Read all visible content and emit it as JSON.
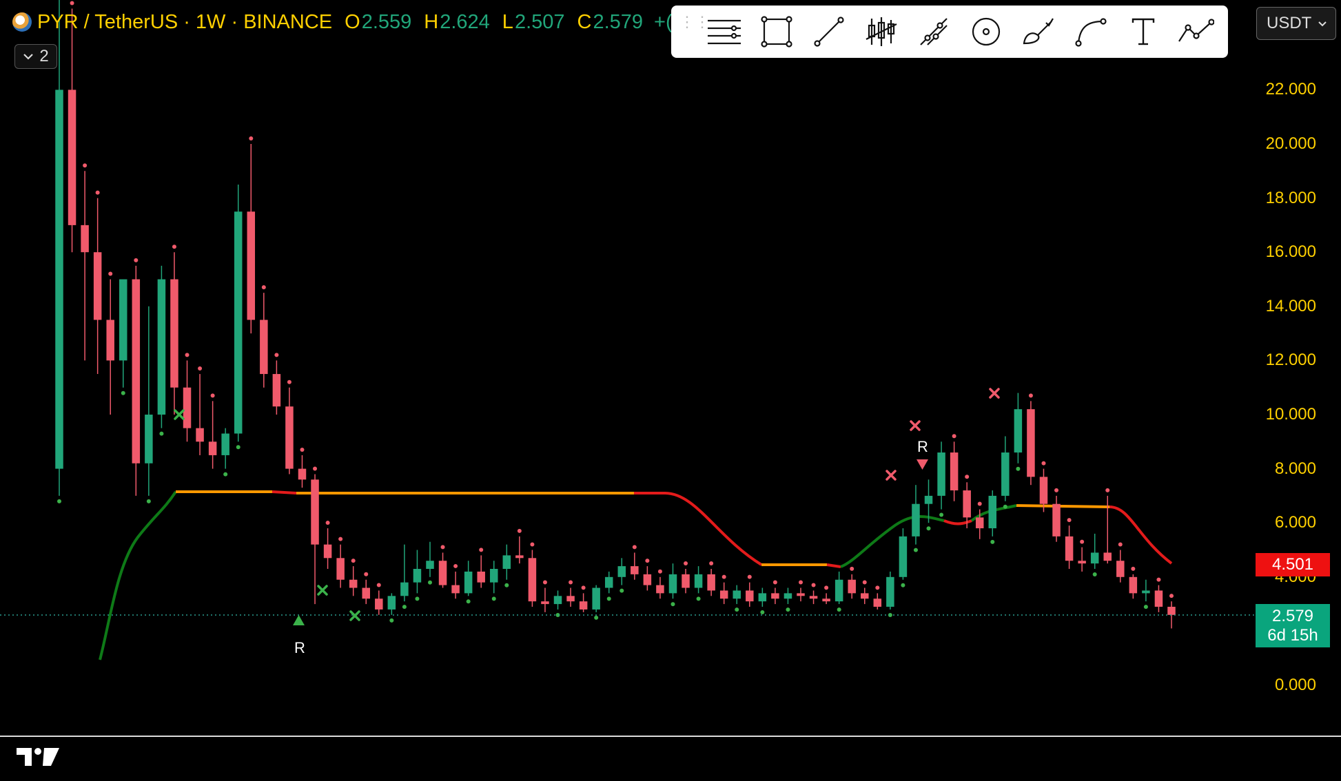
{
  "header": {
    "symbol": "PYR / TetherUS · 1W · BINANCE",
    "open_label": "O",
    "open": "2.559",
    "high_label": "H",
    "high": "2.624",
    "low_label": "L",
    "low": "2.507",
    "close_label": "C",
    "close": "2.579",
    "change_partial": "+("
  },
  "collapse": {
    "label": "2"
  },
  "toolbar": {
    "tools": [
      "horizontal-lines-icon",
      "rectangle-icon",
      "trend-line-icon",
      "candles-icon",
      "path-icon",
      "circle-icon",
      "brush-icon",
      "curve-icon",
      "text-icon",
      "pattern-icon"
    ]
  },
  "currency": {
    "label": "USDT"
  },
  "price_axis": {
    "ticks": [
      "22.000",
      "20.000",
      "18.000",
      "16.000",
      "14.000",
      "12.000",
      "10.000",
      "8.000",
      "6.000",
      "4.000",
      "0.000"
    ]
  },
  "tags": {
    "indicator_price": "4.501",
    "last_price": "2.579",
    "countdown": "6d 15h"
  },
  "markers": {
    "r1": "R",
    "r2": "R"
  },
  "colors": {
    "up": "#21a67a",
    "down": "#f05a6b",
    "accent_yellow": "#ffd000",
    "trail_green": "#0e7a17",
    "trail_orange": "#ff9800",
    "trail_red": "#e31b1b"
  },
  "chart_data": {
    "type": "candlestick",
    "timeframe": "1W",
    "ylim": [
      0,
      23
    ],
    "current_price": 2.579,
    "indicator_level": 4.501,
    "candles_estimated": [
      {
        "o": 8,
        "h": 26,
        "l": 7,
        "c": 22,
        "dir": "up"
      },
      {
        "o": 22,
        "h": 25,
        "l": 16,
        "c": 17,
        "dir": "down"
      },
      {
        "o": 17,
        "h": 19,
        "l": 12,
        "c": 16,
        "dir": "down"
      },
      {
        "o": 16,
        "h": 18,
        "l": 11.5,
        "c": 13.5,
        "dir": "down"
      },
      {
        "o": 13.5,
        "h": 15,
        "l": 10,
        "c": 12,
        "dir": "down"
      },
      {
        "o": 12,
        "h": 15,
        "l": 11,
        "c": 15,
        "dir": "up"
      },
      {
        "o": 15,
        "h": 15.5,
        "l": 7,
        "c": 8.2,
        "dir": "down"
      },
      {
        "o": 8.2,
        "h": 14,
        "l": 7,
        "c": 10,
        "dir": "up"
      },
      {
        "o": 10,
        "h": 15.5,
        "l": 9.5,
        "c": 15,
        "dir": "up"
      },
      {
        "o": 15,
        "h": 16,
        "l": 10,
        "c": 11,
        "dir": "down"
      },
      {
        "o": 11,
        "h": 12,
        "l": 9,
        "c": 9.5,
        "dir": "down"
      },
      {
        "o": 9.5,
        "h": 11.5,
        "l": 8.5,
        "c": 9,
        "dir": "down"
      },
      {
        "o": 9,
        "h": 10.5,
        "l": 8,
        "c": 8.5,
        "dir": "down"
      },
      {
        "o": 8.5,
        "h": 9.5,
        "l": 8,
        "c": 9.3,
        "dir": "up"
      },
      {
        "o": 9.3,
        "h": 18.5,
        "l": 9,
        "c": 17.5,
        "dir": "up"
      },
      {
        "o": 17.5,
        "h": 20,
        "l": 13,
        "c": 13.5,
        "dir": "down"
      },
      {
        "o": 13.5,
        "h": 14.5,
        "l": 11,
        "c": 11.5,
        "dir": "down"
      },
      {
        "o": 11.5,
        "h": 12,
        "l": 10,
        "c": 10.3,
        "dir": "down"
      },
      {
        "o": 10.3,
        "h": 11,
        "l": 7.8,
        "c": 8,
        "dir": "down"
      },
      {
        "o": 8,
        "h": 8.5,
        "l": 7.3,
        "c": 7.6,
        "dir": "down"
      },
      {
        "o": 7.6,
        "h": 7.8,
        "l": 3,
        "c": 5.2,
        "dir": "down"
      },
      {
        "o": 5.2,
        "h": 5.8,
        "l": 4.3,
        "c": 4.7,
        "dir": "down"
      },
      {
        "o": 4.7,
        "h": 5.2,
        "l": 3.6,
        "c": 3.9,
        "dir": "down"
      },
      {
        "o": 3.9,
        "h": 4.4,
        "l": 3.3,
        "c": 3.6,
        "dir": "down"
      },
      {
        "o": 3.6,
        "h": 3.9,
        "l": 3,
        "c": 3.2,
        "dir": "down"
      },
      {
        "o": 3.2,
        "h": 3.5,
        "l": 2.6,
        "c": 2.8,
        "dir": "down"
      },
      {
        "o": 2.8,
        "h": 3.4,
        "l": 2.6,
        "c": 3.3,
        "dir": "up"
      },
      {
        "o": 3.3,
        "h": 5.2,
        "l": 3.1,
        "c": 3.8,
        "dir": "up"
      },
      {
        "o": 3.8,
        "h": 5,
        "l": 3.4,
        "c": 4.3,
        "dir": "up"
      },
      {
        "o": 4.3,
        "h": 5.3,
        "l": 4,
        "c": 4.6,
        "dir": "up"
      },
      {
        "o": 4.6,
        "h": 4.9,
        "l": 3.6,
        "c": 3.7,
        "dir": "down"
      },
      {
        "o": 3.7,
        "h": 4.2,
        "l": 3.2,
        "c": 3.4,
        "dir": "down"
      },
      {
        "o": 3.4,
        "h": 4.6,
        "l": 3.3,
        "c": 4.2,
        "dir": "up"
      },
      {
        "o": 4.2,
        "h": 4.8,
        "l": 3.6,
        "c": 3.8,
        "dir": "down"
      },
      {
        "o": 3.8,
        "h": 4.6,
        "l": 3.4,
        "c": 4.3,
        "dir": "up"
      },
      {
        "o": 4.3,
        "h": 5.2,
        "l": 3.9,
        "c": 4.8,
        "dir": "up"
      },
      {
        "o": 4.8,
        "h": 5.5,
        "l": 4.5,
        "c": 4.7,
        "dir": "down"
      },
      {
        "o": 4.7,
        "h": 5,
        "l": 2.9,
        "c": 3.1,
        "dir": "down"
      },
      {
        "o": 3.1,
        "h": 3.6,
        "l": 2.7,
        "c": 3,
        "dir": "down"
      },
      {
        "o": 3,
        "h": 3.5,
        "l": 2.8,
        "c": 3.3,
        "dir": "up"
      },
      {
        "o": 3.3,
        "h": 3.6,
        "l": 2.9,
        "c": 3.1,
        "dir": "down"
      },
      {
        "o": 3.1,
        "h": 3.4,
        "l": 2.7,
        "c": 2.8,
        "dir": "down"
      },
      {
        "o": 2.8,
        "h": 3.7,
        "l": 2.7,
        "c": 3.6,
        "dir": "up"
      },
      {
        "o": 3.6,
        "h": 4.2,
        "l": 3.4,
        "c": 4,
        "dir": "up"
      },
      {
        "o": 4,
        "h": 4.7,
        "l": 3.7,
        "c": 4.4,
        "dir": "up"
      },
      {
        "o": 4.4,
        "h": 4.9,
        "l": 3.9,
        "c": 4.1,
        "dir": "down"
      },
      {
        "o": 4.1,
        "h": 4.4,
        "l": 3.5,
        "c": 3.7,
        "dir": "down"
      },
      {
        "o": 3.7,
        "h": 4,
        "l": 3.2,
        "c": 3.4,
        "dir": "down"
      },
      {
        "o": 3.4,
        "h": 4.5,
        "l": 3.2,
        "c": 4.1,
        "dir": "up"
      },
      {
        "o": 4.1,
        "h": 4.3,
        "l": 3.4,
        "c": 3.6,
        "dir": "down"
      },
      {
        "o": 3.6,
        "h": 4.4,
        "l": 3.4,
        "c": 4.1,
        "dir": "up"
      },
      {
        "o": 4.1,
        "h": 4.3,
        "l": 3.3,
        "c": 3.5,
        "dir": "down"
      },
      {
        "o": 3.5,
        "h": 3.8,
        "l": 3,
        "c": 3.2,
        "dir": "down"
      },
      {
        "o": 3.2,
        "h": 3.7,
        "l": 3,
        "c": 3.5,
        "dir": "up"
      },
      {
        "o": 3.5,
        "h": 3.8,
        "l": 2.9,
        "c": 3.1,
        "dir": "down"
      },
      {
        "o": 3.1,
        "h": 3.6,
        "l": 2.9,
        "c": 3.4,
        "dir": "up"
      },
      {
        "o": 3.4,
        "h": 3.6,
        "l": 3,
        "c": 3.2,
        "dir": "down"
      },
      {
        "o": 3.2,
        "h": 3.6,
        "l": 3,
        "c": 3.4,
        "dir": "up"
      },
      {
        "o": 3.4,
        "h": 3.6,
        "l": 3.1,
        "c": 3.3,
        "dir": "down"
      },
      {
        "o": 3.3,
        "h": 3.5,
        "l": 3,
        "c": 3.2,
        "dir": "down"
      },
      {
        "o": 3.2,
        "h": 3.4,
        "l": 3,
        "c": 3.1,
        "dir": "down"
      },
      {
        "o": 3.1,
        "h": 4.2,
        "l": 3,
        "c": 3.9,
        "dir": "up"
      },
      {
        "o": 3.9,
        "h": 4.1,
        "l": 3.2,
        "c": 3.4,
        "dir": "down"
      },
      {
        "o": 3.4,
        "h": 3.6,
        "l": 3,
        "c": 3.2,
        "dir": "down"
      },
      {
        "o": 3.2,
        "h": 3.4,
        "l": 2.8,
        "c": 2.9,
        "dir": "down"
      },
      {
        "o": 2.9,
        "h": 4.2,
        "l": 2.8,
        "c": 4,
        "dir": "up"
      },
      {
        "o": 4,
        "h": 5.8,
        "l": 3.9,
        "c": 5.5,
        "dir": "up"
      },
      {
        "o": 5.5,
        "h": 7.4,
        "l": 5.2,
        "c": 6.7,
        "dir": "up"
      },
      {
        "o": 6.7,
        "h": 7.6,
        "l": 6,
        "c": 7,
        "dir": "up"
      },
      {
        "o": 7,
        "h": 9,
        "l": 6.5,
        "c": 8.6,
        "dir": "up"
      },
      {
        "o": 8.6,
        "h": 9,
        "l": 6.8,
        "c": 7.2,
        "dir": "down"
      },
      {
        "o": 7.2,
        "h": 7.5,
        "l": 5.8,
        "c": 6.2,
        "dir": "down"
      },
      {
        "o": 6.2,
        "h": 6.5,
        "l": 5.4,
        "c": 5.8,
        "dir": "down"
      },
      {
        "o": 5.8,
        "h": 7.2,
        "l": 5.5,
        "c": 7,
        "dir": "up"
      },
      {
        "o": 7,
        "h": 9.2,
        "l": 6.8,
        "c": 8.6,
        "dir": "up"
      },
      {
        "o": 8.6,
        "h": 10.8,
        "l": 8.2,
        "c": 10.2,
        "dir": "up"
      },
      {
        "o": 10.2,
        "h": 10.5,
        "l": 7.4,
        "c": 7.7,
        "dir": "down"
      },
      {
        "o": 7.7,
        "h": 8,
        "l": 6.4,
        "c": 6.7,
        "dir": "down"
      },
      {
        "o": 6.7,
        "h": 7,
        "l": 5.3,
        "c": 5.5,
        "dir": "down"
      },
      {
        "o": 5.5,
        "h": 5.9,
        "l": 4.3,
        "c": 4.6,
        "dir": "down"
      },
      {
        "o": 4.6,
        "h": 5.1,
        "l": 4.2,
        "c": 4.5,
        "dir": "down"
      },
      {
        "o": 4.5,
        "h": 5.6,
        "l": 4.3,
        "c": 4.9,
        "dir": "up"
      },
      {
        "o": 4.9,
        "h": 7,
        "l": 4.5,
        "c": 4.6,
        "dir": "down"
      },
      {
        "o": 4.6,
        "h": 5,
        "l": 3.8,
        "c": 4,
        "dir": "down"
      },
      {
        "o": 4,
        "h": 4.1,
        "l": 3.2,
        "c": 3.4,
        "dir": "down"
      },
      {
        "o": 3.4,
        "h": 3.9,
        "l": 3.1,
        "c": 3.5,
        "dir": "up"
      },
      {
        "o": 3.5,
        "h": 3.7,
        "l": 2.7,
        "c": 2.9,
        "dir": "down"
      },
      {
        "o": 2.9,
        "h": 3.1,
        "l": 2.1,
        "c": 2.6,
        "dir": "down"
      }
    ]
  }
}
